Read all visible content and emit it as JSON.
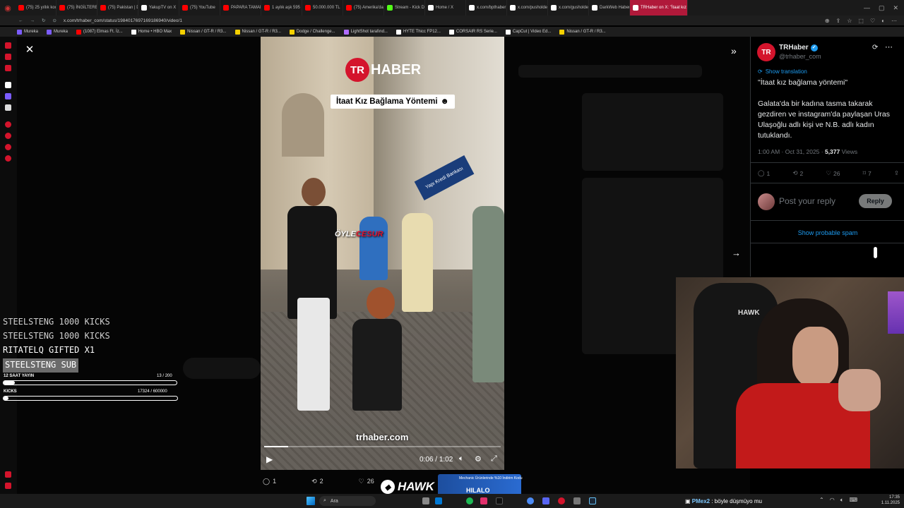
{
  "browser": {
    "tabs": [
      {
        "label": "(75) 25 yıllık koca",
        "color": "#ff0000"
      },
      {
        "label": "(75) İNGİLTERE",
        "color": "#ff0000"
      },
      {
        "label": "(75) Pakistan | D",
        "color": "#ff0000"
      },
      {
        "label": "YakupTV on X",
        "color": "#ffffff"
      },
      {
        "label": "(75) YouTube",
        "color": "#ff0000"
      },
      {
        "label": "PAPARA TAMAM",
        "color": "#ff0000"
      },
      {
        "label": "1 aylık aşk 595 B",
        "color": "#ff0000"
      },
      {
        "label": "50.000.000 TL",
        "color": "#ff0000"
      },
      {
        "label": "(75) Amerika'da",
        "color": "#ff0000"
      },
      {
        "label": "Stream - Kick Da",
        "color": "#53fc18"
      },
      {
        "label": "Home / X",
        "color": "#ffffff"
      },
      {
        "label": "x.com/bpthaber",
        "color": "#ffffff"
      },
      {
        "label": "x.com/pusholder",
        "color": "#ffffff"
      },
      {
        "label": "x.com/gusholder",
        "color": "#ffffff"
      },
      {
        "label": "DarkWeb Haber",
        "color": "#ffffff"
      },
      {
        "label": "TRHaber on X: \"İtaat kız",
        "color": "#ffffff",
        "active": true
      }
    ],
    "url": "x.com/trhaber_com/status/1984017697169186940/video/1",
    "bookmarks": [
      {
        "label": "Mureka",
        "color": "#7b5cff"
      },
      {
        "label": "Mureka",
        "color": "#7b5cff"
      },
      {
        "label": "(1087) Elmas Ft. İz...",
        "color": "#ff0000"
      },
      {
        "label": "Home • HBO Max",
        "color": "#ffffff"
      },
      {
        "label": "Nissan / GT-R / R3...",
        "color": "#f5d000"
      },
      {
        "label": "Nissan / GT-R / R3...",
        "color": "#f5d000"
      },
      {
        "label": "Dodge / Challenge...",
        "color": "#f5d000"
      },
      {
        "label": "LightShot tarafınd...",
        "color": "#b06cff"
      },
      {
        "label": "HYTE Thicc FP12...",
        "color": "#ffffff"
      },
      {
        "label": "CORSAIR RS Serie...",
        "color": "#ffffff"
      },
      {
        "label": "CapCut | Video Ed...",
        "color": "#ffffff"
      },
      {
        "label": "Nissan / GT-R / R3...",
        "color": "#f5d000"
      }
    ]
  },
  "video": {
    "logo_tr": "TR",
    "logo_text": "HABER",
    "caption": "İtaat Kız Bağlama Yöntemi",
    "overlay_word_white": "ÖYLE",
    "overlay_word_red": "CESUR",
    "bank_sign": "Yapı Kredi Bankası",
    "watermark": "trhaber.com",
    "time_current": "0:06",
    "time_total": "1:02",
    "progress_fraction": 0.1
  },
  "below_video_actions": {
    "replies": "1",
    "reposts": "2",
    "likes": "26"
  },
  "tweet": {
    "avatar_text": "TR",
    "author": "TRHaber",
    "handle": "@trhaber_com",
    "translation_link": "Show translation",
    "quote": "\"İtaat kız bağlama yöntemi\"",
    "body": "Galata'da bir kadına tasma takarak gezdiren ve instagram'da paylaşan Uras Ulaşoğlu adlı kişi ve N.B. adlı kadın tutuklandı.",
    "time": "1:00 AM · Oct 31, 2025 · ",
    "views_count": "5,377",
    "views_label": " Views",
    "stats": {
      "replies": "1",
      "reposts": "2",
      "likes": "26",
      "bookmarks": "7"
    },
    "reply_placeholder": "Post your reply",
    "reply_button": "Reply",
    "spam_link": "Show probable spam"
  },
  "stream_overlay": {
    "events": [
      {
        "text": "STEELSTENG  1000 KICKS",
        "style": "dim"
      },
      {
        "text": "STEELSTENG  1000 KICKS",
        "style": "dim"
      },
      {
        "text": "RITATELQ  GIFTED X1",
        "style": "white"
      },
      {
        "text": "STEELSTENG  SUB",
        "style": "sub"
      }
    ],
    "goal1": {
      "label": "12 SAAT YAYIN",
      "current": "13",
      "target": "200",
      "fraction": 0.065
    },
    "goal2": {
      "label": "KICKS",
      "current": "17324",
      "target": "600000",
      "fraction": 0.029
    }
  },
  "webcam": {
    "chair_brand": "HAWK"
  },
  "branding": {
    "hawk": "HAWK",
    "ad_top": "Mechanic Ürünlerinde %10 İndirim Kodu",
    "ad_code": "HILALO"
  },
  "taskbar": {
    "search_placeholder": "Ara",
    "chat_user": "PMex2",
    "chat_message": " : böyle düşmüyo mu",
    "time": "17:35",
    "date": "1.11.2025"
  }
}
